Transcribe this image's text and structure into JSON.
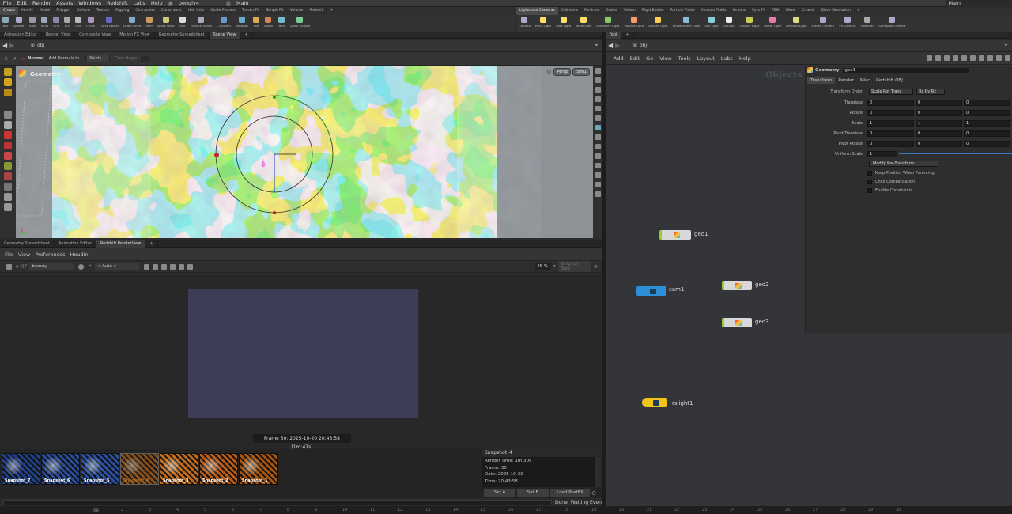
{
  "menubar": {
    "items": [
      "File",
      "Edit",
      "Render",
      "Assets",
      "Windows",
      "Redshift",
      "Labs",
      "Help"
    ],
    "file_name": "pengiv4",
    "desktop": "Main",
    "desktop_right": "Main"
  },
  "shelf_tabs": {
    "left": [
      "Create",
      "Modify",
      "Model",
      "Polygon",
      "Deform",
      "Texture",
      "Rigging",
      "Characters",
      "Constraints",
      "Hair Utils",
      "Guide Process",
      "Terrain FX",
      "Simple FX",
      "Volume",
      "Redshift"
    ],
    "right": [
      "Lights and Cameras",
      "Collisions",
      "Particles",
      "Grains",
      "Vellum",
      "Rigid Bodies",
      "Particle Fluids",
      "Viscous Fluids",
      "Oceans",
      "Pyro FX",
      "FEM",
      "Wires",
      "Crowds",
      "Drive Simulation"
    ]
  },
  "shelf_tools": {
    "left": [
      "Box",
      "Sphere",
      "Tube",
      "Torus",
      "Grid",
      "Null",
      "Line",
      "Circle",
      "Curve Bezier",
      "Draw Curve",
      "Path",
      "Spray Paint",
      "Font",
      "Platonic Solids",
      "L-System",
      "Metaball",
      "File",
      "Spiral",
      "Helix",
      "Quick Shapes"
    ],
    "right": [
      "Camera",
      "Point Light",
      "Spot Light",
      "Area Light",
      "Geometry Light",
      "Volume Light",
      "Distant Light",
      "Environment Light",
      "Sky Light",
      "GI Light",
      "Caustic Light",
      "Portal Light",
      "Ambient Light",
      "Stereo Camera",
      "VR Camera",
      "Switcher",
      "Gamepad Camera"
    ]
  },
  "viewer_tabs": [
    "Animation Editor",
    "Render View",
    "Composite View",
    "Motion FX View",
    "Geometry Spreadsheet",
    "Scene View"
  ],
  "net_tabs": [
    "/obj"
  ],
  "path": {
    "left": "obj",
    "right": "obj"
  },
  "viewer_toolbar": {
    "mode": "Normal",
    "add_normals": "Add Normals to",
    "points": "Points",
    "cusp": "Cusp Angle"
  },
  "viewport": {
    "title": "Geometry",
    "persp": "Persp",
    "cam": "cam1"
  },
  "lower_tabs": [
    "Geometry Spreadsheet",
    "Animation Editor",
    "Redshift RenderView"
  ],
  "rv_menu": [
    "File",
    "View",
    "Preferences",
    "Houdini"
  ],
  "rv_toolbar": {
    "rt": "RT",
    "aov": "beauty",
    "camera": "< Auto >",
    "zoom": "45 %",
    "size": "Original Size"
  },
  "render_caption": "Frame 30: 2025-10-20 20:43:58 (1m:47s)",
  "snapshots": [
    "Snapshot_7",
    "Snapshot_6",
    "Snapshot_5",
    "Snapshot_4",
    "Snapshot_3",
    "Snapshot_2",
    "Snapshot_1"
  ],
  "snapshot_info": {
    "title": "Snapshot_4",
    "lines": [
      "Render Time: 1m:30s",
      "Frame: 30",
      "Date: 2025-10-20",
      "Time: 20:43:58"
    ]
  },
  "rv_buttons": {
    "set_a": "Set A",
    "set_b": "Set B",
    "load": "Load PostFX"
  },
  "status": "Done. Waiting Events",
  "net_menu": [
    "Add",
    "Edit",
    "Go",
    "View",
    "Tools",
    "Layout",
    "Labs",
    "Help"
  ],
  "net_watermark": "Objects",
  "nodes": [
    {
      "name": "geo1"
    },
    {
      "name": "cam1"
    },
    {
      "name": "geo2"
    },
    {
      "name": "geo3"
    },
    {
      "name": "rslight1"
    }
  ],
  "params": {
    "type": "Geometry",
    "name": "geo1",
    "tabs": [
      "Transform",
      "Render",
      "Misc",
      "Redshift OBJ"
    ],
    "transform_order_label": "Transform Order",
    "transform_order": "Scale Rot Trans",
    "rot_order": "Rx Ry Rz",
    "rows": [
      {
        "label": "Translate",
        "v": [
          "0",
          "0",
          "0"
        ]
      },
      {
        "label": "Rotate",
        "v": [
          "0",
          "0",
          "0"
        ]
      },
      {
        "label": "Scale",
        "v": [
          "1",
          "1",
          "1"
        ]
      },
      {
        "label": "Pivot Translate",
        "v": [
          "0",
          "0",
          "0"
        ]
      },
      {
        "label": "Pivot Rotate",
        "v": [
          "0",
          "0",
          "0"
        ]
      }
    ],
    "uniform_label": "Uniform Scale",
    "uniform": "1",
    "modify": "Modify Pre-Transform",
    "checks": [
      "Keep Position When Parenting",
      "Child Compensation",
      "Enable Constraints"
    ]
  },
  "timeline": [
    "1",
    "2",
    "3",
    "4",
    "5",
    "6",
    "7",
    "8",
    "9",
    "10",
    "11",
    "12",
    "13",
    "14",
    "15",
    "16",
    "17",
    "18",
    "19",
    "20",
    "21",
    "22",
    "23",
    "24",
    "25",
    "26",
    "27",
    "28",
    "29",
    "30"
  ],
  "colors": {
    "accent": "#ff9a2e",
    "node_geo": "#9acd32",
    "node_cam": "#2d8fd6",
    "node_light": "#f0c419"
  }
}
